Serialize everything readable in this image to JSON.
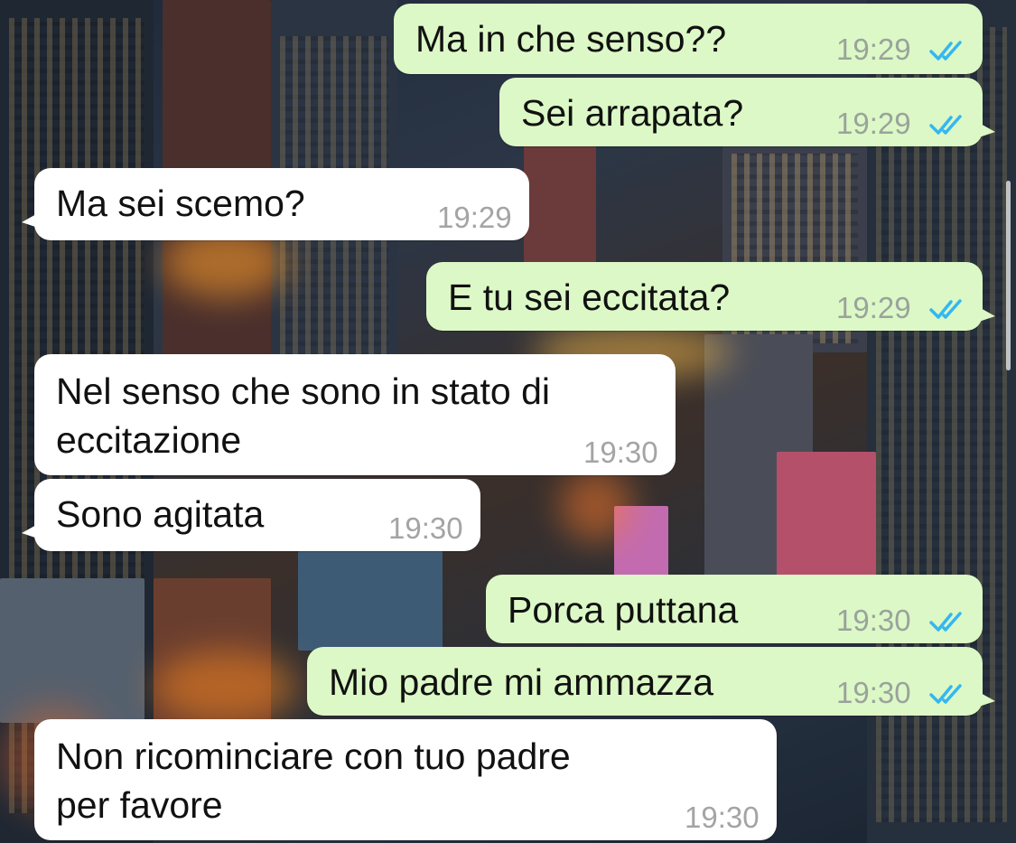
{
  "messages": [
    {
      "dir": "out",
      "text": "Ma in che senso??",
      "time": "19:29",
      "read": true
    },
    {
      "dir": "out",
      "text": "Sei arrapata?",
      "time": "19:29",
      "read": true
    },
    {
      "dir": "in",
      "text": "Ma sei scemo?",
      "time": "19:29"
    },
    {
      "dir": "out",
      "text": "E tu sei eccitata?",
      "time": "19:29",
      "read": true
    },
    {
      "dir": "in",
      "text": "Nel senso che sono in stato di\neccitazione",
      "time": "19:30"
    },
    {
      "dir": "in",
      "text": "Sono agitata",
      "time": "19:30"
    },
    {
      "dir": "out",
      "text": "Porca puttana",
      "time": "19:30",
      "read": true
    },
    {
      "dir": "out",
      "text": "Mio padre mi ammazza",
      "time": "19:30",
      "read": true
    },
    {
      "dir": "in",
      "text": "Non ricominciare con tuo padre\nper favore",
      "time": "19:30"
    }
  ],
  "colors": {
    "outgoing": "#dcf8c6",
    "incoming": "#ffffff",
    "read_check": "#34b7f1",
    "timestamp": "#9aa39c"
  },
  "icons": {
    "read_receipt": "double-check-icon"
  }
}
